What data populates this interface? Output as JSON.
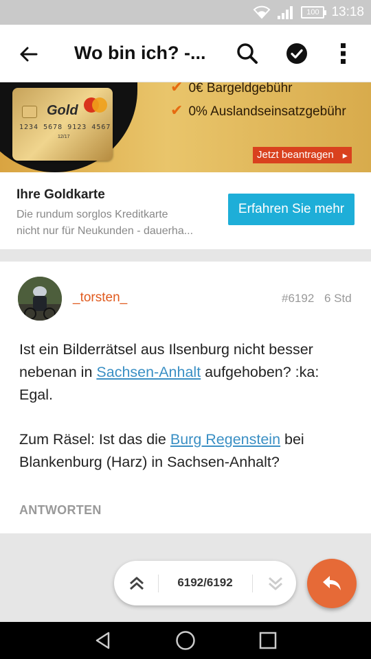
{
  "status_bar": {
    "battery": "100",
    "time": "13:18"
  },
  "app_bar": {
    "title": "Wo bin ich? -..."
  },
  "ad": {
    "bullets": [
      "0€ Bargeldgebühr",
      "0% Auslandseinsatzgebühr"
    ],
    "cta_label": "Jetzt beantragen",
    "card_brand": "Gold",
    "card_number": "1234 5678 9123 4567",
    "card_expiry": "12/17",
    "title": "Ihre Goldkarte",
    "description_lines": [
      "Die rundum sorglos Kreditkarte",
      "nicht nur für Neukunden - dauerha..."
    ],
    "button_label": "Erfahren Sie mehr"
  },
  "post": {
    "author": "_torsten_",
    "number": "#6192",
    "time": "6 Std",
    "p1_before": "Ist ein Bilderrätsel aus Ilsenburg nicht besser nebenan in ",
    "p1_link": "Sachsen-Anhalt",
    "p1_after": " aufgehoben? :ka: Egal.",
    "p2_before": "Zum Räsel: Ist das die ",
    "p2_link": "Burg Regenstein",
    "p2_after": " bei Blankenburg (Harz) in Sachsen-Anhalt?",
    "reply_label": "ANTWORTEN"
  },
  "pager": {
    "count": "6192/6192"
  },
  "colors": {
    "accent": "#e66a37",
    "link": "#3a8fc4",
    "ad_button": "#1eaed8"
  }
}
